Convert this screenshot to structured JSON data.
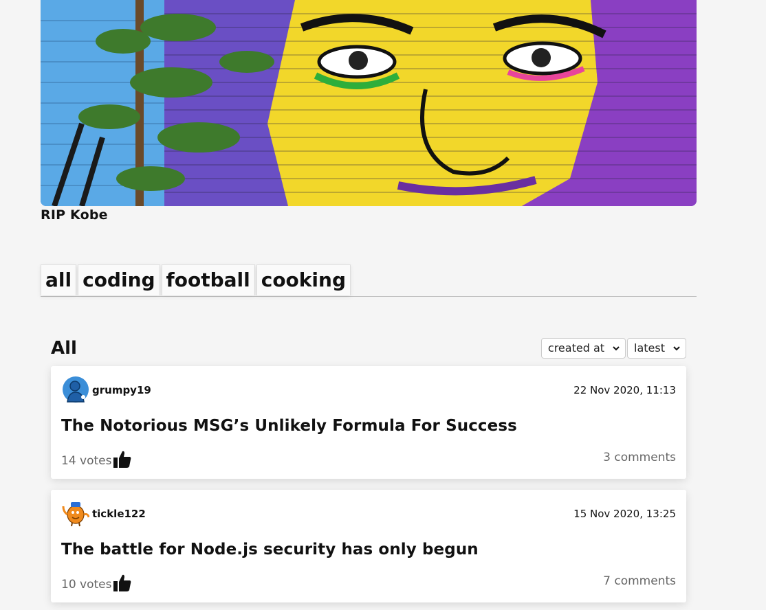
{
  "hero": {
    "image": "kobe-bryant-street-mural",
    "caption": "RIP Kobe"
  },
  "topics": [
    {
      "label": "all"
    },
    {
      "label": "coding"
    },
    {
      "label": "football"
    },
    {
      "label": "cooking"
    }
  ],
  "list": {
    "title": "All",
    "sort_by": "created at",
    "order": "latest"
  },
  "articles": [
    {
      "author": "grumpy19",
      "avatar_icon": "blue-figure-avatar",
      "date": "22 Nov 2020, 11:13",
      "title": "The Notorious MSG’s Unlikely Formula For Success",
      "votes": "14 votes",
      "comments": "3 comments"
    },
    {
      "author": "tickle122",
      "avatar_icon": "mr-tickle-avatar",
      "date": "15 Nov 2020, 13:25",
      "title": "The battle for Node.js security has only begun",
      "votes": "10 votes",
      "comments": "7 comments"
    }
  ],
  "colors": {
    "page_bg": "#f5f5f5",
    "card_bg": "#ffffff",
    "muted_text": "#666666"
  }
}
